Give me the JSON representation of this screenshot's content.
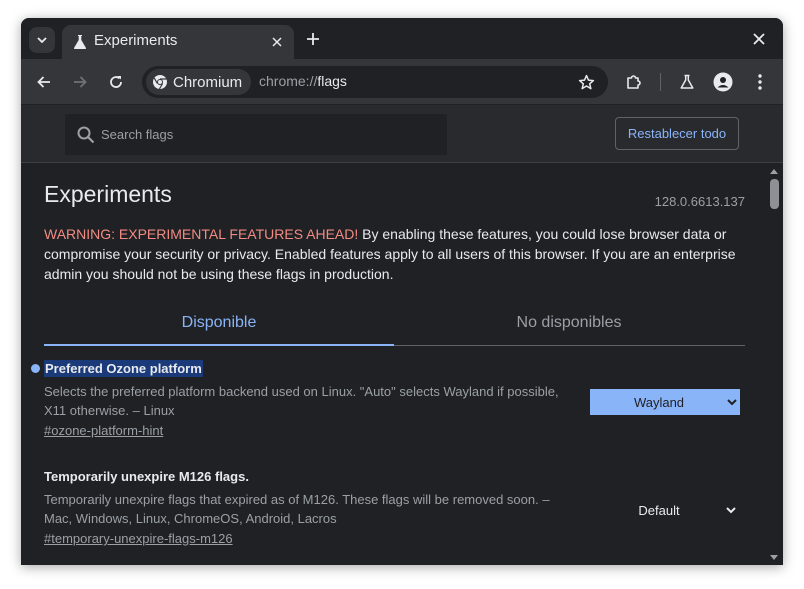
{
  "tab": {
    "title": "Experiments"
  },
  "toolbar": {
    "chip_label": "Chromium",
    "url_scheme": "chrome://",
    "url_host": "flags"
  },
  "flags_header": {
    "search_placeholder": "Search flags",
    "reset_label": "Restablecer todo"
  },
  "main": {
    "title": "Experiments",
    "version": "128.0.6613.137",
    "warning_label": "WARNING: EXPERIMENTAL FEATURES AHEAD!",
    "warning_text": " By enabling these features, you could lose browser data or compromise your security or privacy. Enabled features apply to all users of this browser. If you are an enterprise admin you should not be using these flags in production.",
    "tabs": [
      {
        "label": "Disponible"
      },
      {
        "label": "No disponibles"
      }
    ]
  },
  "flags": [
    {
      "name": "Preferred Ozone platform",
      "description": "Selects the preferred platform backend used on Linux. \"Auto\" selects Wayland if possible, X11 otherwise. – Linux",
      "link": "#ozone-platform-hint",
      "selected": "Wayland"
    },
    {
      "name": "Temporarily unexpire M126 flags.",
      "description": "Temporarily unexpire flags that expired as of M126. These flags will be removed soon. – Mac, Windows, Linux, ChromeOS, Android, Lacros",
      "link": "#temporary-unexpire-flags-m126",
      "selected": "Default"
    }
  ],
  "colors": {
    "accent": "#8ab4f8",
    "warning": "#f28b82",
    "background": "#202124"
  }
}
